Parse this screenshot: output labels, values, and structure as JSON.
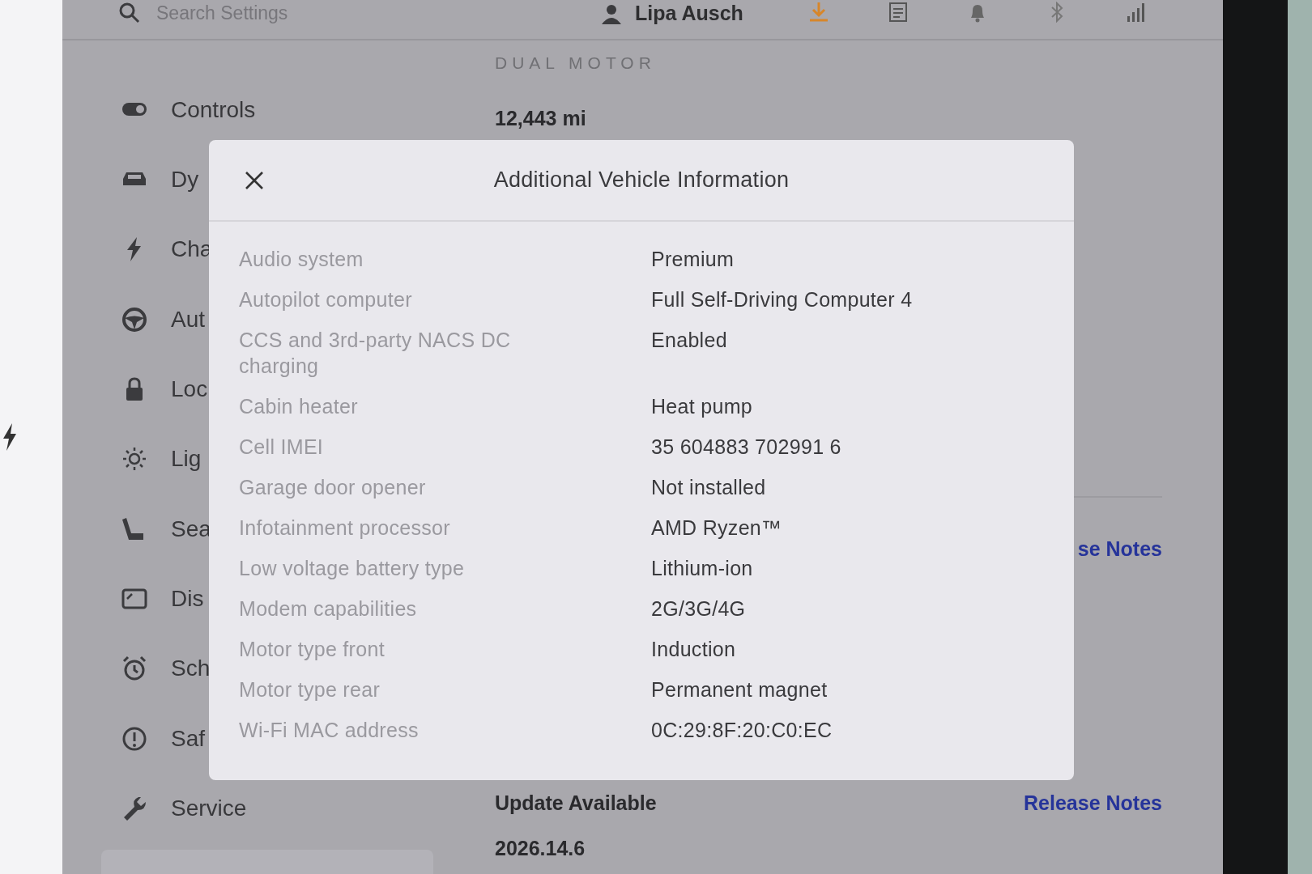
{
  "top_bar": {
    "search": {
      "placeholder": "Search Settings"
    },
    "profile_name": "Lipa Ausch"
  },
  "sidebar": {
    "items": [
      {
        "label": "Controls"
      },
      {
        "label": "Dy"
      },
      {
        "label": "Cha"
      },
      {
        "label": "Aut"
      },
      {
        "label": "Loc"
      },
      {
        "label": "Lig"
      },
      {
        "label": "Sea"
      },
      {
        "label": "Dis"
      },
      {
        "label": "Sch"
      },
      {
        "label": "Saf"
      },
      {
        "label": "Service"
      }
    ]
  },
  "main": {
    "model_badge": "DUAL MOTOR",
    "odometer": "12,443  mi",
    "partial_link": "se Notes",
    "update_status": "Update Available",
    "release_notes_link": "Release Notes",
    "version": "2026.14.6"
  },
  "modal": {
    "title": "Additional Vehicle Information",
    "rows": [
      {
        "label": "Audio system",
        "value": "Premium"
      },
      {
        "label": "Autopilot computer",
        "value": "Full Self-Driving Computer 4"
      },
      {
        "label": "CCS and 3rd-party NACS DC charging",
        "value": "Enabled"
      },
      {
        "label": "Cabin heater",
        "value": "Heat pump"
      },
      {
        "label": "Cell IMEI",
        "value": "35 604883 702991 6"
      },
      {
        "label": "Garage door opener",
        "value": "Not installed"
      },
      {
        "label": "Infotainment processor",
        "value": "AMD Ryzen™"
      },
      {
        "label": "Low voltage battery type",
        "value": "Lithium-ion"
      },
      {
        "label": "Modem capabilities",
        "value": "2G/3G/4G"
      },
      {
        "label": "Motor type front",
        "value": "Induction"
      },
      {
        "label": "Motor type rear",
        "value": "Permanent magnet"
      },
      {
        "label": "Wi-Fi MAC address",
        "value": "0C:29:8F:20:C0:EC"
      }
    ]
  }
}
